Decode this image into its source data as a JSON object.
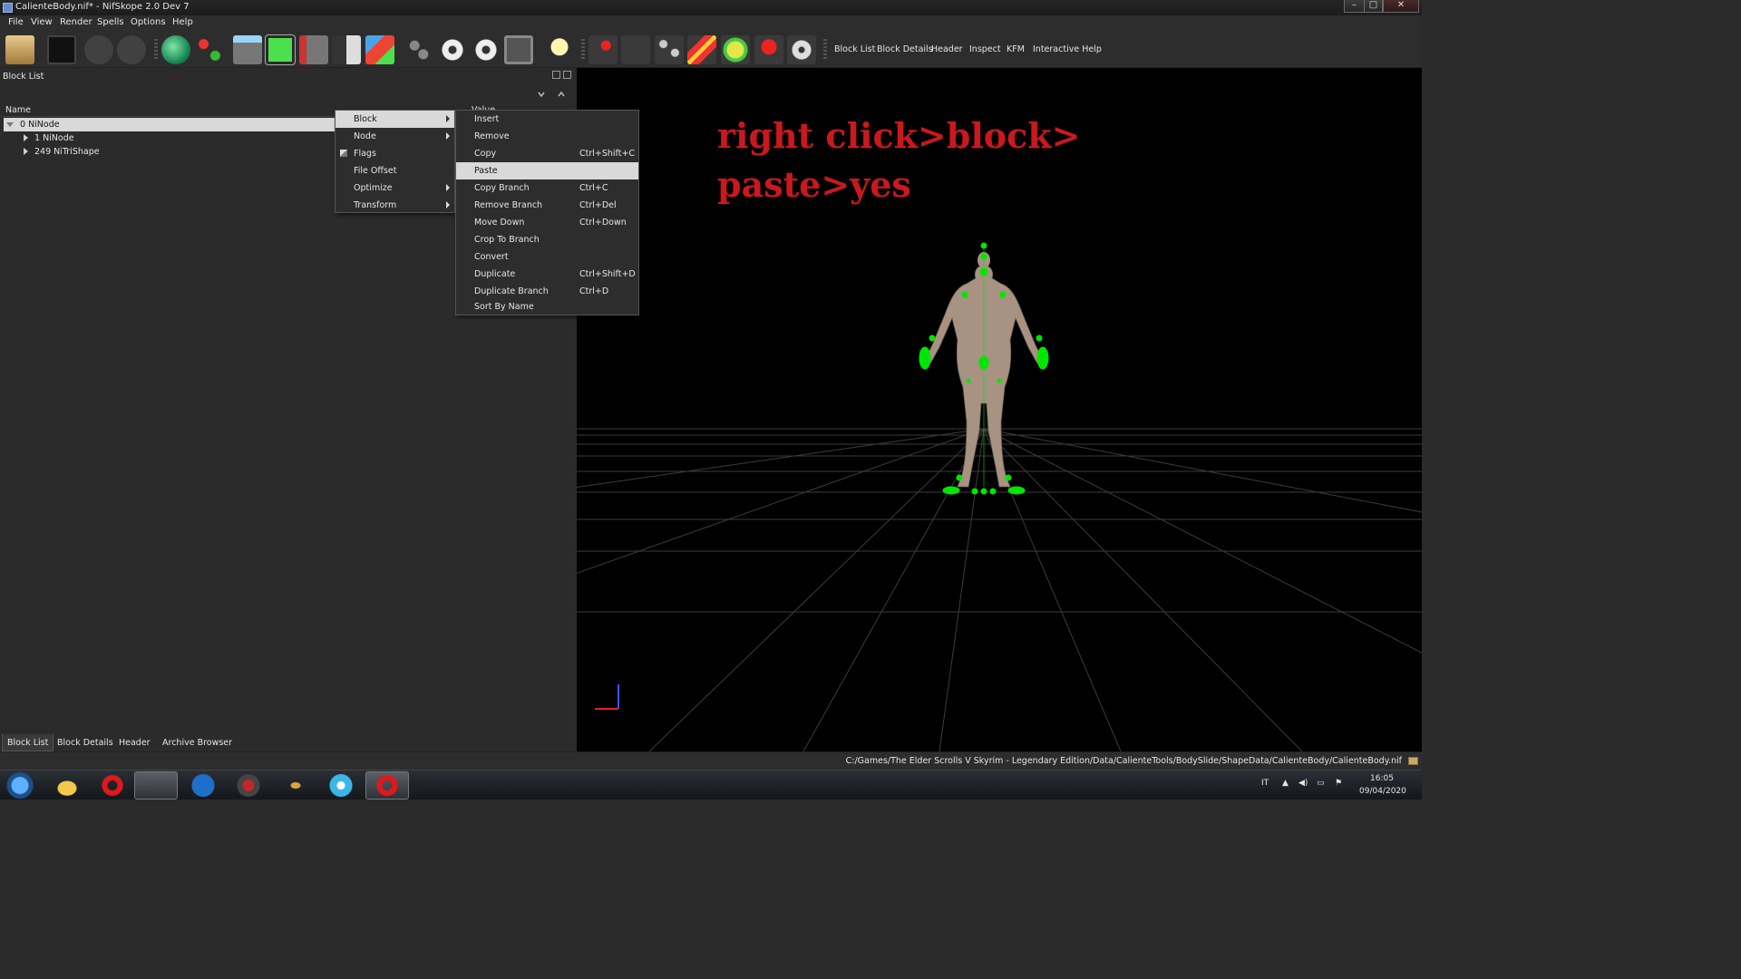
{
  "window": {
    "title": "CalienteBody.nif* - NifSkope 2.0 Dev 7",
    "min_glyph": "–",
    "max_glyph": "□",
    "close_glyph": "✕"
  },
  "menubar": {
    "items": [
      "File",
      "View",
      "Render",
      "Spells",
      "Options",
      "Help"
    ]
  },
  "toolbar": {
    "icons": [
      "open-icon",
      "save-icon",
      "undo-icon",
      "redo-icon",
      "select-object-icon",
      "select-vertex-icon",
      "view-flat-icon",
      "view-front-icon",
      "view-side-icon",
      "view-back-icon",
      "view-cube-icon",
      "walk-icon",
      "show-hidden-icon",
      "show-nodes-icon",
      "screenshot-icon",
      "lighting-icon",
      "marker-icon",
      "axes-icon",
      "skeleton-icon",
      "constraints-icon",
      "havok-icon",
      "markers-icon",
      "visibility-icon"
    ],
    "text_buttons": [
      "Block List",
      "Block Details",
      "Header",
      "Inspect",
      "KFM",
      "Interactive Help"
    ]
  },
  "block_list": {
    "title": "Block List",
    "columns": [
      "Name",
      "Value"
    ],
    "rows": [
      {
        "label": "0 NiNode",
        "selected": true
      },
      {
        "label": "1 NiNode",
        "selected": false
      },
      {
        "label": "249 NiTriShape",
        "selected": false
      }
    ]
  },
  "context_menu": {
    "items": [
      {
        "label": "Block",
        "submenu": true,
        "highlighted": true
      },
      {
        "label": "Node",
        "submenu": true
      },
      {
        "label": "Flags",
        "submenu": false
      },
      {
        "label": "File Offset",
        "submenu": false
      },
      {
        "label": "Optimize",
        "submenu": true
      },
      {
        "label": "Transform",
        "submenu": true
      }
    ]
  },
  "block_submenu": {
    "items": [
      {
        "label": "Insert",
        "shortcut": ""
      },
      {
        "label": "Remove",
        "shortcut": ""
      },
      {
        "label": "Copy",
        "shortcut": "Ctrl+Shift+C"
      },
      {
        "label": "Paste",
        "shortcut": "",
        "highlighted": true
      },
      {
        "label": "Copy Branch",
        "shortcut": "Ctrl+C"
      },
      {
        "label": "Remove Branch",
        "shortcut": "Ctrl+Del"
      },
      {
        "label": "Move Down",
        "shortcut": "Ctrl+Down"
      },
      {
        "label": "Crop To Branch",
        "shortcut": ""
      },
      {
        "label": "Convert",
        "shortcut": ""
      },
      {
        "label": "Duplicate",
        "shortcut": "Ctrl+Shift+D"
      },
      {
        "label": "Duplicate Branch",
        "shortcut": "Ctrl+D"
      },
      {
        "label": "Sort By Name",
        "shortcut": ""
      }
    ]
  },
  "annotation": {
    "line1": "right click>block>",
    "line2": "paste>yes"
  },
  "bottom_tabs": [
    "Block List",
    "Block Details",
    "Header",
    "Archive Browser"
  ],
  "status": {
    "path": "C:/Games/The Elder Scrolls V Skyrim - Legendary Edition/Data/CalienteTools/BodySlide/ShapeData/CalienteBody/CalienteBody.nif"
  },
  "taskbar": {
    "apps": [
      "start-icon",
      "explorer-icon",
      "opera-icon",
      "media-center-icon",
      "ffdec-icon",
      "game-icon",
      "bodyslide-icon",
      "itunes-icon",
      "opera-active-icon"
    ],
    "language": "IT",
    "time": "16:05",
    "date": "09/04/2020"
  },
  "colors": {
    "accent_red": "#c9181e",
    "bone_green": "#00e600",
    "menu_highlight": "#d9d9d9"
  }
}
